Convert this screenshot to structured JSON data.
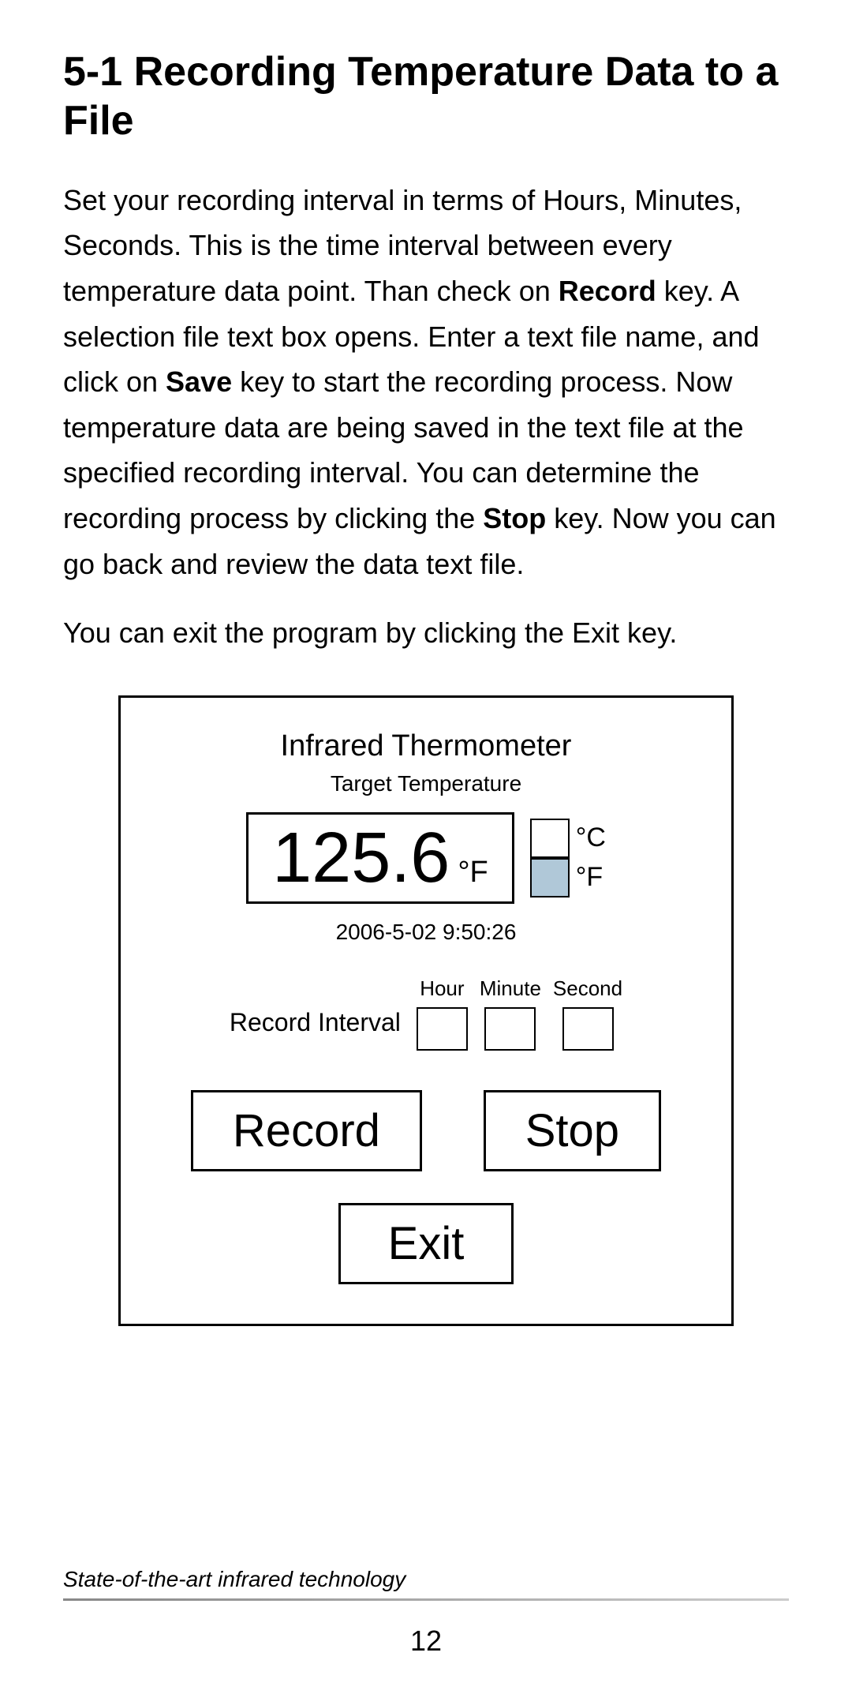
{
  "page": {
    "title": "5-1 Recording Temperature Data to a File",
    "description_p1": "Set your recording interval in terms of Hours, Minutes, Seconds. This is the time interval between every temperature data point. Than check on ",
    "description_bold1": "Record",
    "description_p2": " key. A selection file text box opens. Enter a text file name, and click on ",
    "description_bold2": "Save",
    "description_p3": " key to start the recording process. Now temperature data are being saved in the text file at the specified recording interval. You can determine the recording process by clicking the ",
    "description_bold3": "Stop",
    "description_p4": " key. Now you can go back and review the data text file.",
    "exit_description_p1": "You can exit the program by clicking the ",
    "exit_bold": "Exit",
    "exit_description_p2": " key.",
    "panel": {
      "title": "Infrared Thermometer",
      "subtitle": "Target Temperature",
      "temperature_value": "125.6",
      "temperature_unit_f": "°F",
      "unit_celsius": "°C",
      "unit_fahrenheit": "°F",
      "timestamp": "2006-5-02   9:50:26",
      "record_interval_label": "Record Interval",
      "hour_label": "Hour",
      "minute_label": "Minute",
      "second_label": "Second",
      "record_button": "Record",
      "stop_button": "Stop",
      "exit_button": "Exit"
    },
    "footer": {
      "tagline": "State-of-the-art infrared technology",
      "page_number": "12"
    }
  }
}
